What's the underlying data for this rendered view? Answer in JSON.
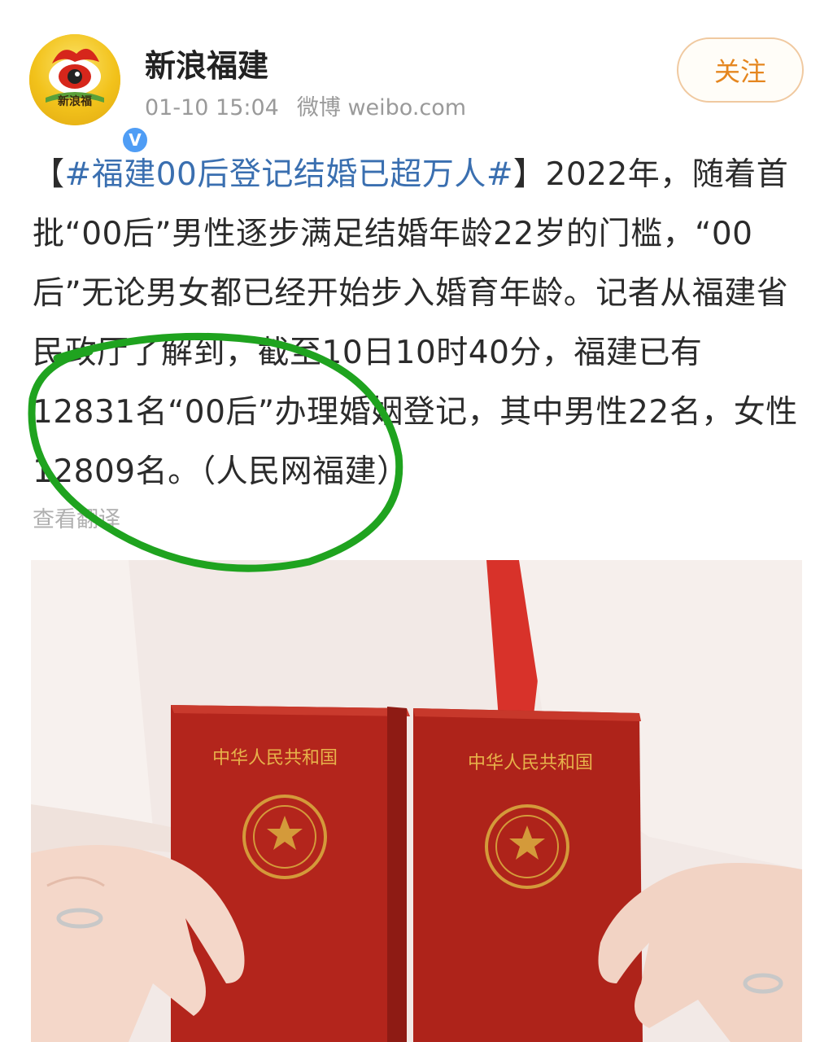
{
  "post": {
    "author": "新浪福建",
    "avatar_label": "新浪福",
    "verified_mark": "V",
    "timestamp": "01-10 15:04",
    "source": "微博 weibo.com",
    "follow_label": "关注",
    "content": {
      "bracket_open": "【",
      "hashtag": "#福建00后登记结婚已超万人#",
      "bracket_close": "】",
      "text": "2022年，随着首批“00后”男性逐步满足结婚年龄22岁的门槛，“00后”无论男女都已经开始步入婚育年龄。记者从福建省民政厅了解到，截至10日10时40分，福建已有12831名“00后”办理婚姻登记，其中男性22名，女性12809名。（人民网福建）"
    },
    "translate_label": "查看翻译",
    "photo": {
      "certificate_title_left": "中华人民共和国",
      "certificate_title_right": "中华人民共和国"
    }
  },
  "colors": {
    "hashtag": "#3a6fb0",
    "follow_text": "#e5861f",
    "annotation_circle": "#1fa31f",
    "certificate": "#b3251c"
  },
  "icons": [
    "verified-icon",
    "national-emblem-icon"
  ]
}
